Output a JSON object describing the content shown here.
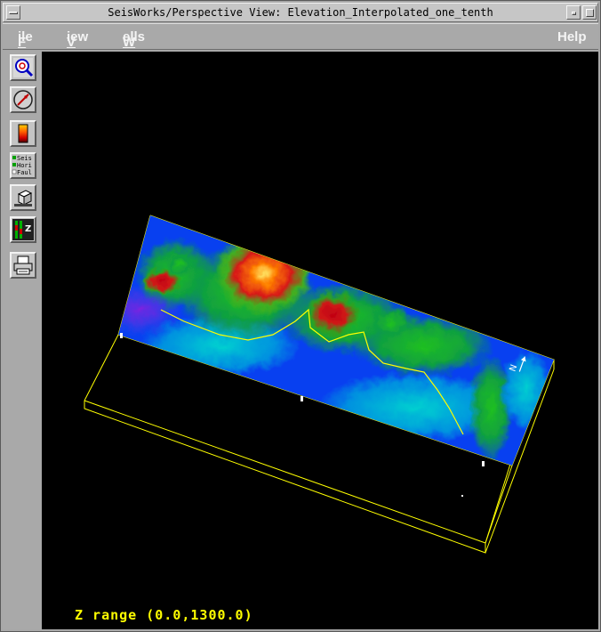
{
  "window": {
    "title": "SeisWorks/Perspective View: Elevation_Interpolated_one_tenth"
  },
  "titlebar_buttons": [
    "window-menu-icon",
    "minimize-icon",
    "maximize-icon"
  ],
  "menu": {
    "left": [
      {
        "label": "File",
        "mnemonic": "F",
        "rest": "ile"
      },
      {
        "label": "View",
        "mnemonic": "V",
        "rest": "iew"
      },
      {
        "label": "Wells",
        "mnemonic": "W",
        "rest": "ells"
      }
    ],
    "right": {
      "label": "Help"
    }
  },
  "toolbar": {
    "tools": [
      {
        "name": "zoom-tool",
        "icon": "magnifier-icon"
      },
      {
        "name": "rotate-tool",
        "icon": "compass-icon"
      },
      {
        "name": "colorbar-tool",
        "icon": "color-scale-icon"
      },
      {
        "name": "display-layers-tool",
        "icon": "layers-list-icon",
        "lines": [
          "Seis",
          "Hori",
          "Faul"
        ]
      },
      {
        "name": "cube-tool",
        "icon": "cube-icon"
      },
      {
        "name": "z-scale-tool",
        "icon": "z-scale-icon",
        "letter": "Z"
      },
      {
        "name": "print-tool",
        "icon": "printer-icon"
      }
    ]
  },
  "viewport": {
    "z_range_text": "Z range (0.0,1300.0)",
    "north_label": "N",
    "colors": {
      "background": "#000000",
      "box_outline": "#ffff00",
      "well_path": "#ffff00"
    }
  }
}
